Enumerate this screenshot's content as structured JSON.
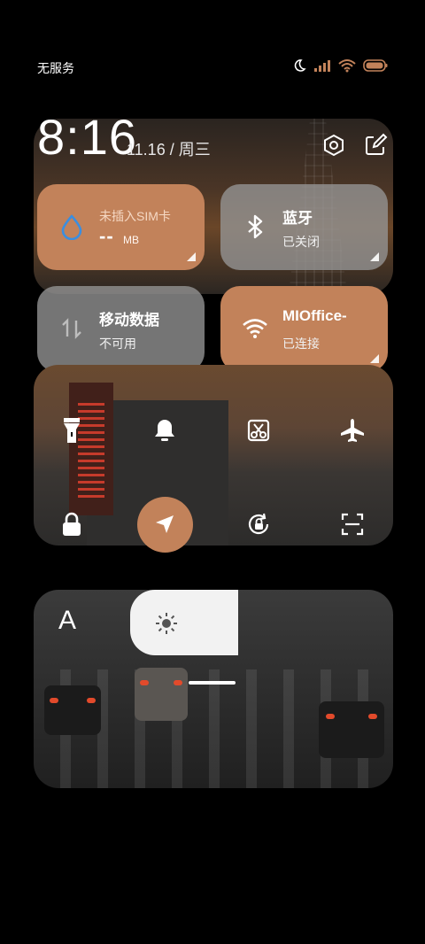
{
  "status_bar": {
    "carrier": "无服务",
    "icons": [
      "moon-icon",
      "signal-icon",
      "wifi-icon",
      "battery-icon"
    ]
  },
  "header": {
    "time": "8:16",
    "date": "11.16 / 周三",
    "icons": [
      "settings-icon",
      "edit-icon"
    ]
  },
  "tiles": [
    {
      "id": "data-usage",
      "title": "未插入SIM卡",
      "value": "--",
      "unit": "MB",
      "icon": "water-drop-icon"
    },
    {
      "id": "bluetooth",
      "title": "蓝牙",
      "status": "已关闭",
      "icon": "bluetooth-icon"
    },
    {
      "id": "mobile-data",
      "title": "移动数据",
      "status": "不可用",
      "icon": "data-arrows-icon"
    },
    {
      "id": "wifi",
      "title": "MIOffice-",
      "status": "已连接",
      "icon": "wifi-icon"
    }
  ],
  "quick_toggles": [
    "flashlight-icon",
    "bell-icon",
    "screenshot-icon",
    "airplane-icon",
    "lock-icon",
    "location-icon",
    "rotation-lock-icon",
    "scan-icon"
  ],
  "brightness": {
    "auto_label": "A",
    "icon": "sun-icon"
  },
  "colors": {
    "accent": "#c2825a",
    "tile_gray": "#969696"
  }
}
